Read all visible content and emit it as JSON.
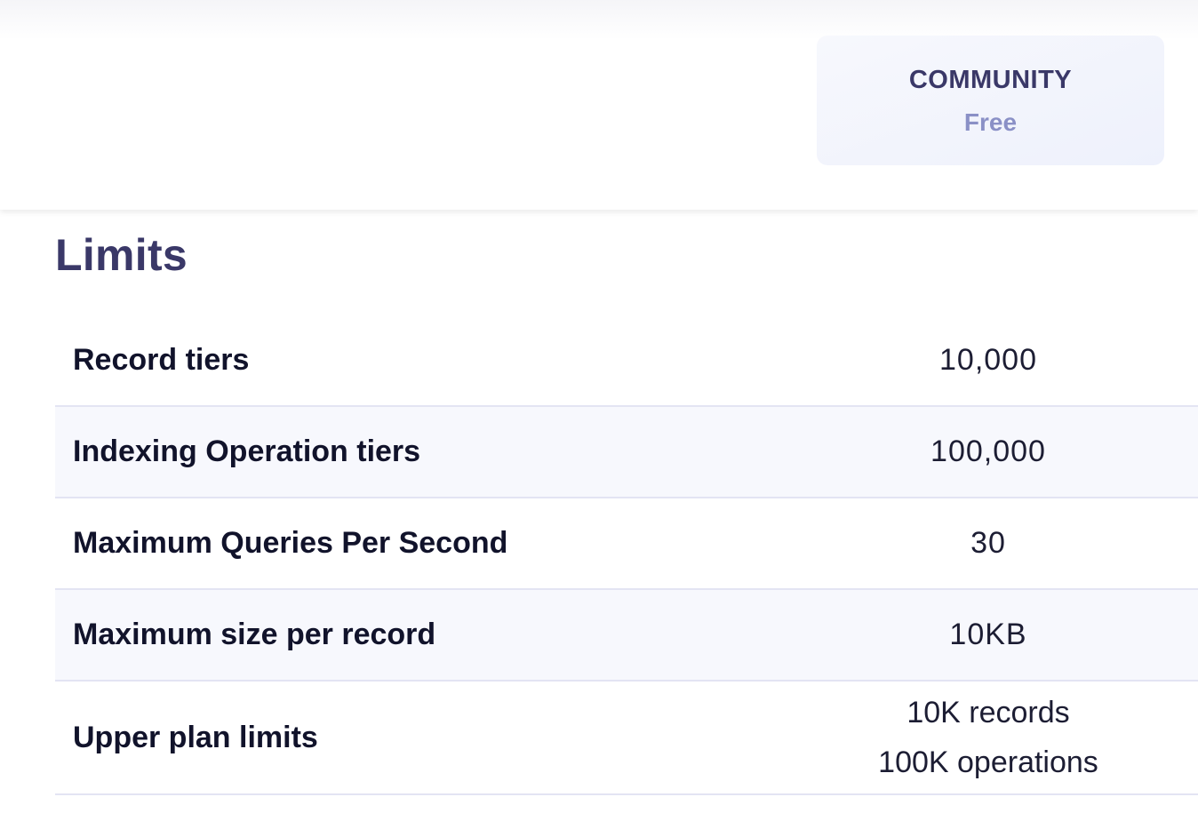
{
  "plan": {
    "name": "COMMUNITY",
    "price": "Free"
  },
  "section": {
    "title": "Limits"
  },
  "limits": {
    "rows": [
      {
        "label": "Record tiers",
        "value": "10,000"
      },
      {
        "label": "Indexing Operation tiers",
        "value": "100,000"
      },
      {
        "label": "Maximum Queries Per Second",
        "value": "30"
      },
      {
        "label": "Maximum size per record",
        "value": "10KB"
      },
      {
        "label": "Upper plan limits",
        "value_lines": [
          "10K records",
          "100K operations"
        ]
      }
    ]
  },
  "colors": {
    "heading": "#3a3868",
    "price": "#8a90c6",
    "row_alt_bg": "#f7f8fd",
    "divider": "#e3e4f3"
  }
}
